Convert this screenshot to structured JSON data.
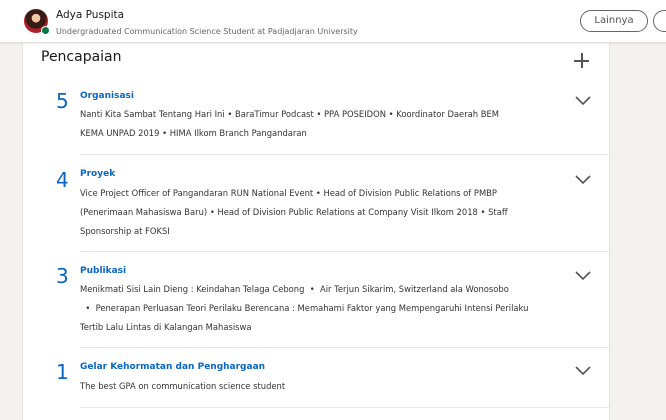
{
  "profile": {
    "name": "Adya Puspita",
    "headline": "Undergraduated Communication Science Student at Padjadjaran University",
    "more_button": "Lainnya"
  },
  "card": {
    "title": "Pencapaian",
    "sections": [
      {
        "count": "5",
        "title": "Organisasi",
        "lines": [
          "Nanti Kita Sambat Tentang Hari Ini  •  BaraTimur Podcast  •  PPA POSEIDON  •  Koordinator Daerah BEM",
          "KEMA UNPAD 2019  •  HIMA Ilkom Branch Pangandaran"
        ]
      },
      {
        "count": "4",
        "title": "Proyek",
        "lines": [
          "Vice Project Officer of Pangandaran RUN National Event  •  Head of Division Public Relations of PMBP",
          "(Penerimaan Mahasiswa Baru)  •  Head of Division Public Relations at Company Visit Ilkom 2018  •  Staff",
          "Sponsorship at FOKSI"
        ]
      },
      {
        "count": "3",
        "title": "Publikasi",
        "lines": [
          "Menikmati Sisi Lain Dieng : Keindahan Telaga Cebong  •  Air Terjun Sikarim, Switzerland ala Wonosobo",
          "  •  Penerapan Perluasan Teori Perilaku Berencana : Memahami Faktor yang Mempengaruhi Intensi Perilaku",
          "Tertib Lalu Lintas di Kalangan Mahasiswa"
        ]
      },
      {
        "count": "1",
        "title": "Gelar Kehormatan dan Penghargaan",
        "lines": [
          "The best GPA on communication science student"
        ]
      }
    ]
  },
  "colors": {
    "accent": "#0a66c2",
    "presence": "#057642"
  },
  "icons": {
    "add": "plus-icon",
    "expand": "chevron-down-icon"
  }
}
